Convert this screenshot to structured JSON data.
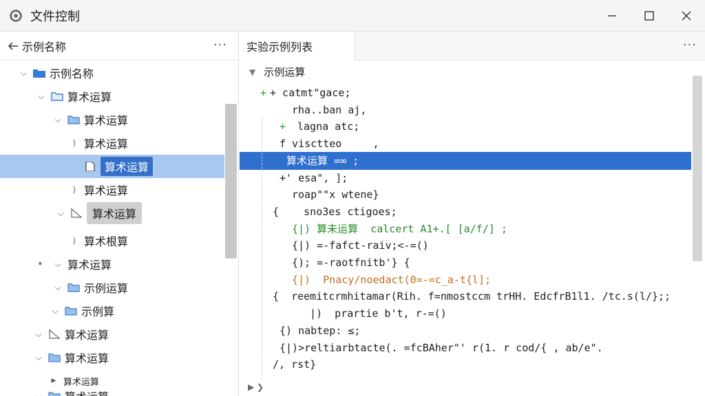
{
  "window": {
    "title": "文件控制"
  },
  "left": {
    "back_label": "示例名称",
    "more": "···",
    "tree": [
      {
        "label": "示例名称",
        "caret": "open",
        "icon": "folder-blue"
      },
      {
        "label": "算术运算",
        "caret": "open",
        "icon": "folder-outline"
      },
      {
        "label": "算术运算",
        "caret": "open",
        "icon": "folder-light"
      },
      {
        "label": "算术运算",
        "caret": "leaf",
        "icon": "none"
      },
      {
        "label": "算术运算",
        "caret": "file",
        "icon": "file",
        "selected": true
      },
      {
        "label": "算术运算",
        "caret": "leaf",
        "icon": "none"
      },
      {
        "label": "算术运算",
        "caret": "open",
        "icon": "triangle",
        "grey": true
      },
      {
        "label": "算术根算",
        "caret": "leaf",
        "icon": "none"
      },
      {
        "label": "算术运算",
        "caret": "open-dot",
        "icon": "none"
      },
      {
        "label": "示例运算",
        "caret": "open",
        "icon": "folder-light"
      },
      {
        "label": "示例算",
        "caret": "open",
        "icon": "folder-light"
      },
      {
        "label": "算术运算",
        "caret": "open",
        "icon": "triangle"
      },
      {
        "label": "算术运算",
        "caret": "open",
        "icon": "folder-light"
      },
      {
        "label": "算术运算",
        "caret": "closed",
        "icon": "none",
        "small": true
      },
      {
        "label": "算术运算",
        "caret": "open",
        "icon": "folder-light"
      }
    ]
  },
  "right": {
    "tab_label": "实验示例列表",
    "more": "···",
    "section_title": "示例运算",
    "code": [
      {
        "text": "+ catmt\"gace;",
        "marker": "+"
      },
      {
        "text": "rha..ban aj,",
        "marker": ""
      },
      {
        "text": "lagna atc;",
        "marker": "+"
      },
      {
        "text": "f visctteo     ,",
        "marker": ""
      },
      {
        "text": "算术运算 =∞ ;",
        "marker": "",
        "selected": true
      },
      {
        "text": "+' esa\", ];",
        "marker": ""
      },
      {
        "text": "roap\"\"x wtene}",
        "marker": ""
      },
      {
        "text": "{    sno3es ctigoes;",
        "marker": ""
      },
      {
        "text": "{|) 算未运算  calcert A1+.[ [a/f/] ;",
        "marker": ""
      },
      {
        "text": "{|) =-fafct-raiv;<-=()",
        "marker": ""
      },
      {
        "text": "{); =-raotfnitb'} {",
        "marker": ""
      },
      {
        "text": "{|)  Pnacy/noedact(0=-=c_a-t{l];",
        "marker": ""
      },
      {
        "text": "{  reemitcrmhitamar(Rih. f=nmostccm trHH. EdcfrB1l1. /tc.s(l/};;",
        "marker": ""
      },
      {
        "text": "  |)  prartie b't, r-=()",
        "marker": ""
      },
      {
        "text": "{) nabtep: ≤;",
        "marker": ""
      },
      {
        "text": "{|)>reltiarbtacte(. =fcBAher\"' r(1. r cod/{ , ab/e\".",
        "marker": ""
      },
      {
        "text": "/, rst}",
        "marker": ""
      }
    ]
  },
  "colors": {
    "selection": "#2f6fce",
    "tree_selection": "#a8c8f0",
    "folder": "#3a7bd5",
    "green": "#2a8a2a"
  }
}
